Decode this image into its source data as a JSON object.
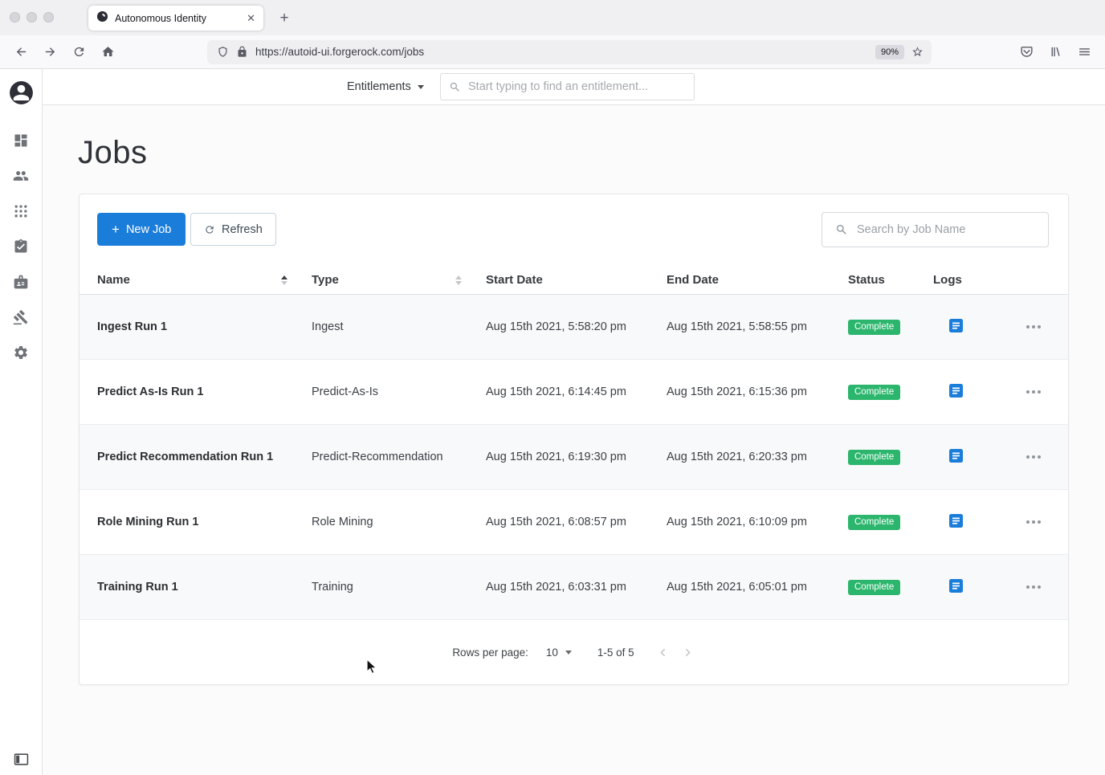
{
  "browser": {
    "tab_title": "Autonomous Identity",
    "url": "https://autoid-ui.forgerock.com/jobs",
    "zoom_level": "90%"
  },
  "topbar": {
    "context_label": "Entitlements",
    "search_placeholder": "Start typing to find an entitlement..."
  },
  "page": {
    "title": "Jobs"
  },
  "toolbar": {
    "new_job": "New Job",
    "refresh": "Refresh",
    "job_search_placeholder": "Search by Job Name"
  },
  "table": {
    "columns": {
      "name": "Name",
      "type": "Type",
      "start": "Start Date",
      "end": "End Date",
      "status": "Status",
      "logs": "Logs"
    },
    "rows": [
      {
        "name": "Ingest Run 1",
        "type": "Ingest",
        "start": "Aug 15th 2021, 5:58:20 pm",
        "end": "Aug 15th 2021, 5:58:55 pm",
        "status": "Complete"
      },
      {
        "name": "Predict As-Is Run 1",
        "type": "Predict-As-Is",
        "start": "Aug 15th 2021, 6:14:45 pm",
        "end": "Aug 15th 2021, 6:15:36 pm",
        "status": "Complete"
      },
      {
        "name": "Predict Recommendation Run 1",
        "type": "Predict-Recommendation",
        "start": "Aug 15th 2021, 6:19:30 pm",
        "end": "Aug 15th 2021, 6:20:33 pm",
        "status": "Complete"
      },
      {
        "name": "Role Mining Run 1",
        "type": "Role Mining",
        "start": "Aug 15th 2021, 6:08:57 pm",
        "end": "Aug 15th 2021, 6:10:09 pm",
        "status": "Complete"
      },
      {
        "name": "Training Run 1",
        "type": "Training",
        "start": "Aug 15th 2021, 6:03:31 pm",
        "end": "Aug 15th 2021, 6:05:01 pm",
        "status": "Complete"
      }
    ]
  },
  "pagination": {
    "rows_per_page_label": "Rows per page:",
    "rows_per_page": "10",
    "range": "1-5 of 5"
  },
  "colors": {
    "accent": "#1b7dda",
    "success": "#2cb66d"
  }
}
